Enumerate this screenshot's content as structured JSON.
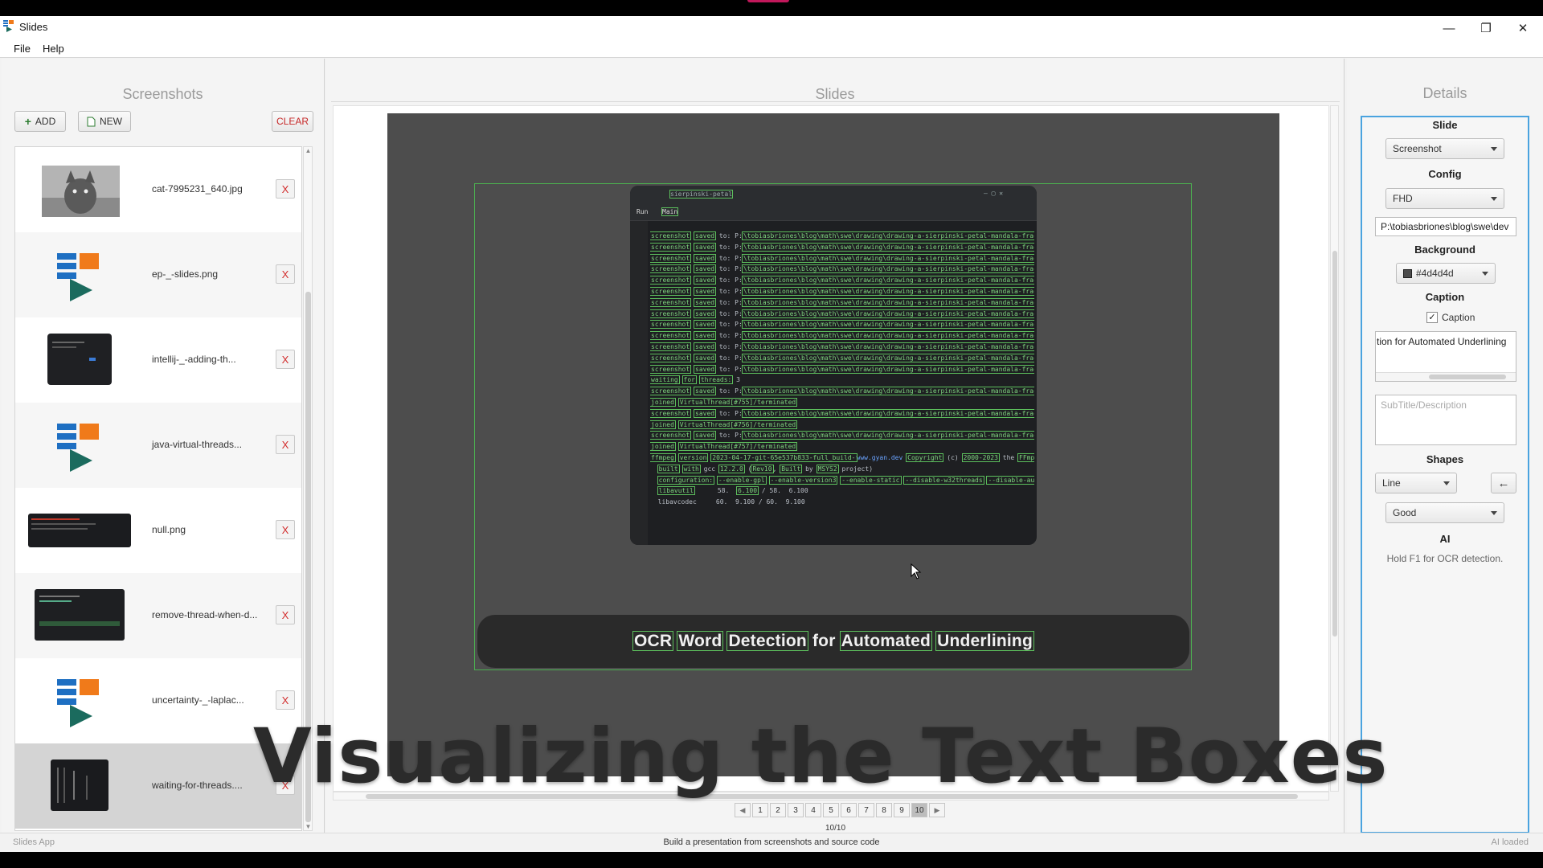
{
  "window": {
    "title": "Slides"
  },
  "menu": [
    "File",
    "Help"
  ],
  "screenshots_panel": {
    "title": "Screenshots",
    "add_label": "ADD",
    "new_label": "NEW",
    "clear_label": "CLEAR",
    "remove_label": "X",
    "items": [
      {
        "name": "cat-7995231_640.jpg",
        "thumb": "cat-photo"
      },
      {
        "name": "ep-_-slides.png",
        "thumb": "app-logo"
      },
      {
        "name": "intellij-_-adding-th...",
        "thumb": "dark-ide"
      },
      {
        "name": "java-virtual-threads...",
        "thumb": "app-logo"
      },
      {
        "name": "null.png",
        "thumb": "dark-wide"
      },
      {
        "name": "remove-thread-when-d...",
        "thumb": "dark-code"
      },
      {
        "name": "uncertainty-_-laplac...",
        "thumb": "app-logo"
      },
      {
        "name": "waiting-for-threads....",
        "thumb": "dark-terminal"
      }
    ]
  },
  "slides_panel": {
    "title": "Slides",
    "caption": [
      "OCR",
      "Word",
      "Detection",
      "for",
      "Automated",
      "Underlining"
    ],
    "pages": [
      "1",
      "2",
      "3",
      "4",
      "5",
      "6",
      "7",
      "8",
      "9",
      "10"
    ],
    "current_page": "10",
    "page_count": "10/10",
    "screenshot": {
      "tab_run": "Run",
      "tab_main": "Main",
      "window_label": "sierpinski-petal"
    }
  },
  "overlay_title": "Visualizing the Text Boxes",
  "details_panel": {
    "title": "Details",
    "slide_label": "Slide",
    "slide_type": "Screenshot",
    "config_label": "Config",
    "config_value": "FHD",
    "config_path": "P:\\tobiasbriones\\blog\\swe\\dev",
    "background_label": "Background",
    "background_value": "#4d4d4d",
    "caption_label": "Caption",
    "caption_checkbox_label": "Caption",
    "caption_text": "tion for Automated Underlining",
    "subtitle_placeholder": "SubTitle/Description",
    "shapes_label": "Shapes",
    "shape_value": "Line",
    "quality_value": "Good",
    "ai_label": "AI",
    "ai_hint": "Hold F1 for OCR detection."
  },
  "status_bar": {
    "left": "Slides App",
    "center": "Build a presentation from screenshots and source code",
    "right": "AI loaded"
  },
  "colors": {
    "accent": "#4aa3df",
    "slide_bg": "#4d4d4d",
    "ocr_box": "#5cbf5c",
    "remove": "#d32f2f"
  }
}
